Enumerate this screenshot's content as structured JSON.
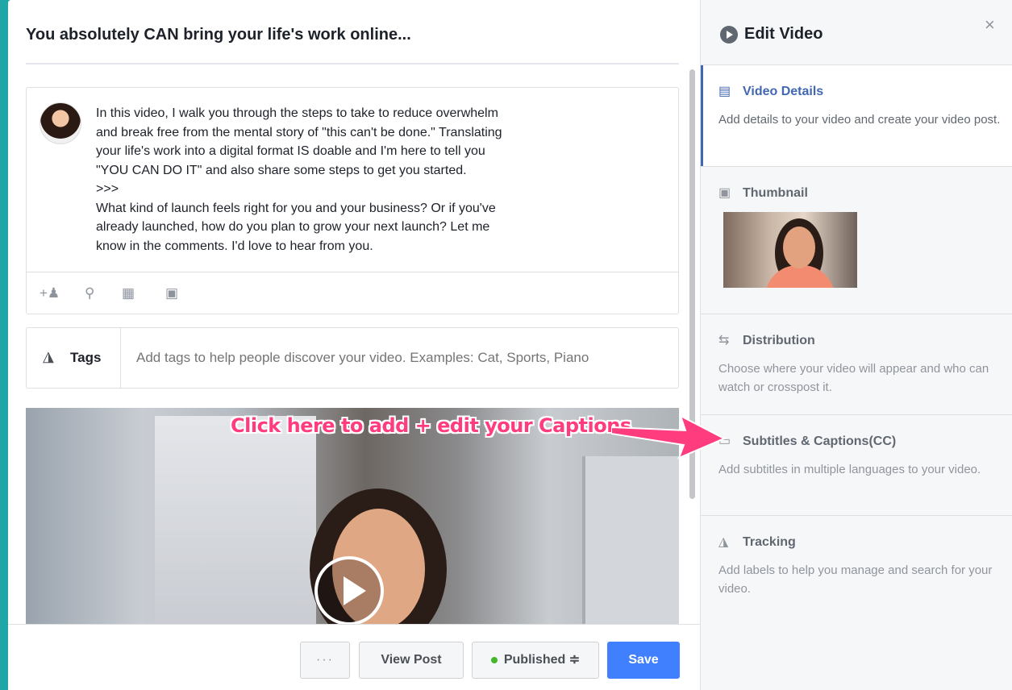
{
  "post": {
    "title": "You absolutely CAN bring your life's work online...",
    "description": "In this video, I walk you through the steps to take to reduce overwhelm\nand break free from the mental story of \"this can't be done.\" Translating\nyour life's work into a digital format IS doable and I'm here to tell you\n\"YOU CAN DO IT\" and also share some steps to get you started.\n>>>\nWhat kind of launch feels right for you and your business? Or if you've\nalready launched, how do you plan to grow your next launch? Let me\nknow in the comments. I'd love to hear from you.",
    "icons": [
      "tag-people-icon",
      "location-icon",
      "calendar-icon",
      "feeling-icon"
    ]
  },
  "tags": {
    "label": "Tags",
    "placeholder": "Add tags to help people discover your video. Examples: Cat, Sports, Piano"
  },
  "annotation": {
    "text": "Click here to add + edit your Captions",
    "color": "#ff3c7d"
  },
  "footer": {
    "more_label": "···",
    "view_post_label": "View Post",
    "status_label": "Published ≑",
    "status_color": "#42b72a",
    "save_label": "Save"
  },
  "panel": {
    "title": "Edit Video",
    "close": "×",
    "sections": [
      {
        "label": "Video Details",
        "desc": "Add details to your video and create your video post.",
        "active": true
      },
      {
        "label": "Thumbnail"
      },
      {
        "label": "Distribution",
        "desc": "Choose where your video will appear and who can watch or crosspost it."
      },
      {
        "label": "Subtitles & Captions(CC)",
        "desc": "Add subtitles in multiple languages to your video."
      },
      {
        "label": "Tracking",
        "desc": "Add labels to help you manage and search for your video."
      }
    ]
  },
  "colors": {
    "background": "#1fa7a7",
    "accent": "#4267b2",
    "save_button": "#4080ff"
  }
}
